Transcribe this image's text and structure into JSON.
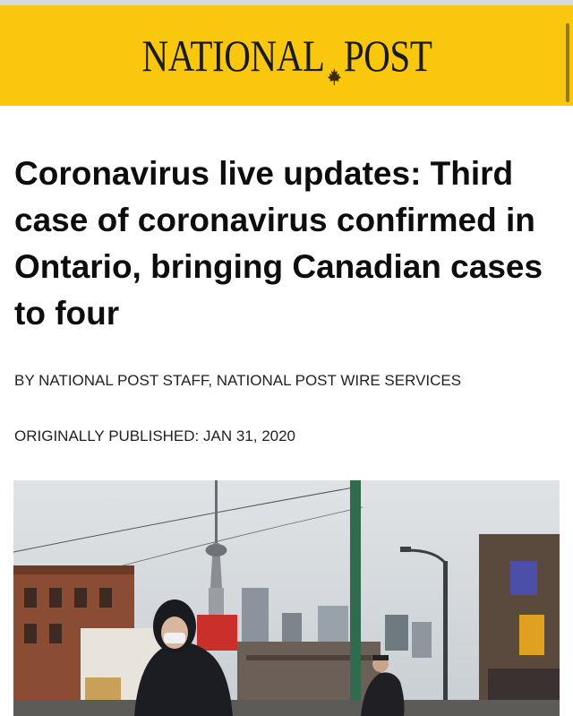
{
  "masthead": {
    "logo_left": "NATIONAL",
    "logo_right": "POST",
    "logo_icon": "maple-leaf-icon",
    "background": "#f9c80e"
  },
  "article": {
    "headline": "Coronavirus live updates: Third case of coronavirus confirmed in Ontario, bringing Canadian cases to four",
    "byline": "BY NATIONAL POST STAFF, NATIONAL POST WIRE SERVICES",
    "published": "ORIGINALLY PUBLISHED: JAN 31, 2020"
  },
  "hero_image": {
    "subject": "Toronto street scene with CN Tower and masked cyclists"
  }
}
